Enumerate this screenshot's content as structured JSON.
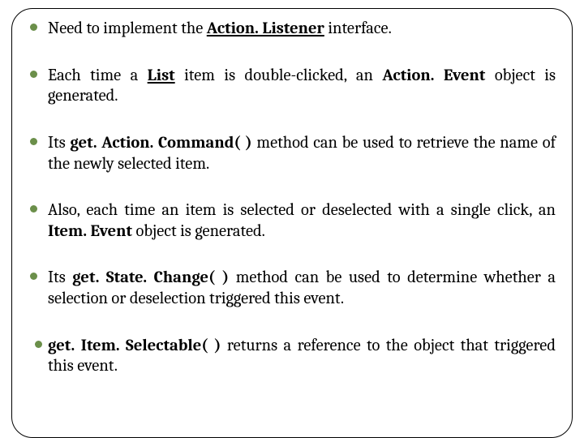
{
  "bullets": {
    "b1": {
      "t1": "Need to implement the ",
      "t2": "Action. Listener",
      "t3": " interface."
    },
    "b2": {
      "t1": "Each time a ",
      "t2": "List",
      "t3": " item is double-clicked, an ",
      "t4": "Action. Event",
      "t5": " object is generated."
    },
    "b3": {
      "t1": "Its ",
      "t2": "get. Action. Command( )",
      "t3": " method can be used to retrieve the name of the newly selected item."
    },
    "b4": {
      "t1": "Also, each time an item is selected or deselected with a single click, an ",
      "t2": "Item. Event",
      "t3": " object is generated."
    },
    "b5": {
      "t1": "Its ",
      "t2": "get. State. Change( )",
      "t3": " method can be used to determine whether a selection or deselection triggered this event."
    },
    "b6": {
      "t1": "get. Item. Selectable( )",
      "t2": " returns a reference to the object that triggered this event."
    }
  }
}
